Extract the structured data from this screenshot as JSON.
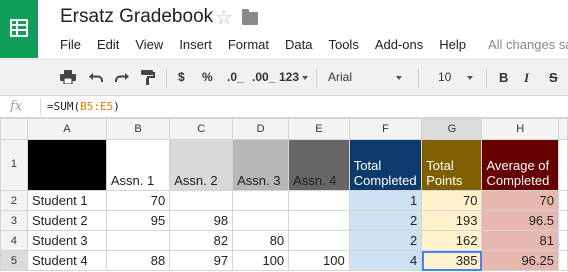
{
  "app": {
    "doc_title": "Ersatz Gradebook",
    "star_icon": "star-icon",
    "folder_icon": "folder-icon",
    "save_status": "All changes sa",
    "brand_color": "#0f9d58"
  },
  "menu": [
    "File",
    "Edit",
    "View",
    "Insert",
    "Format",
    "Data",
    "Tools",
    "Add-ons",
    "Help"
  ],
  "toolbar": {
    "icons": [
      "print-icon",
      "undo-icon",
      "redo-icon",
      "paint-format-icon"
    ],
    "currency": "$",
    "percent": "%",
    "decrease_decimal": ".0_",
    "increase_decimal": ".00_",
    "more_formats": "123",
    "font": "Arial",
    "font_size": "10",
    "bold": "B",
    "italic": "I",
    "strikethrough": "S"
  },
  "formula_bar": {
    "fx_label": "fx",
    "prefix": "=SUM(",
    "range": "B5:E5",
    "suffix": ")"
  },
  "grid": {
    "selected_cell": "G5",
    "columns": [
      "A",
      "B",
      "C",
      "D",
      "E",
      "F",
      "G",
      "H"
    ],
    "header_row": {
      "row_number": "1",
      "cells": [
        "",
        "Assn. 1",
        "Assn. 2",
        "Assn. 3",
        "Assn. 4",
        "Total Completed",
        "Total Points",
        "Average of Completed"
      ],
      "backgrounds": [
        "#000000",
        "#ffffff",
        "#d9d9d9",
        "#b7b7b7",
        "#666666",
        "#0b3a6e",
        "#7f6000",
        "#660000"
      ],
      "text_colors": [
        "#222222",
        "#222222",
        "#222222",
        "#222222",
        "#222222",
        "#ffffff",
        "#ffffff",
        "#ffffff"
      ]
    },
    "rows": [
      {
        "row_number": "2",
        "cells": [
          "Student 1",
          "70",
          "",
          "",
          "",
          "1",
          "70",
          "70"
        ]
      },
      {
        "row_number": "3",
        "cells": [
          "Student 2",
          "95",
          "98",
          "",
          "",
          "2",
          "193",
          "96.5"
        ]
      },
      {
        "row_number": "4",
        "cells": [
          "Student 3",
          "",
          "82",
          "80",
          "",
          "2",
          "162",
          "81"
        ]
      },
      {
        "row_number": "5",
        "cells": [
          "Student 4",
          "88",
          "97",
          "100",
          "100",
          "4",
          "385",
          "96.25"
        ]
      }
    ],
    "data_fill_colors": {
      "F": "#cfe2f3",
      "G": "#fff2cc",
      "H": "#e6b8af"
    }
  }
}
